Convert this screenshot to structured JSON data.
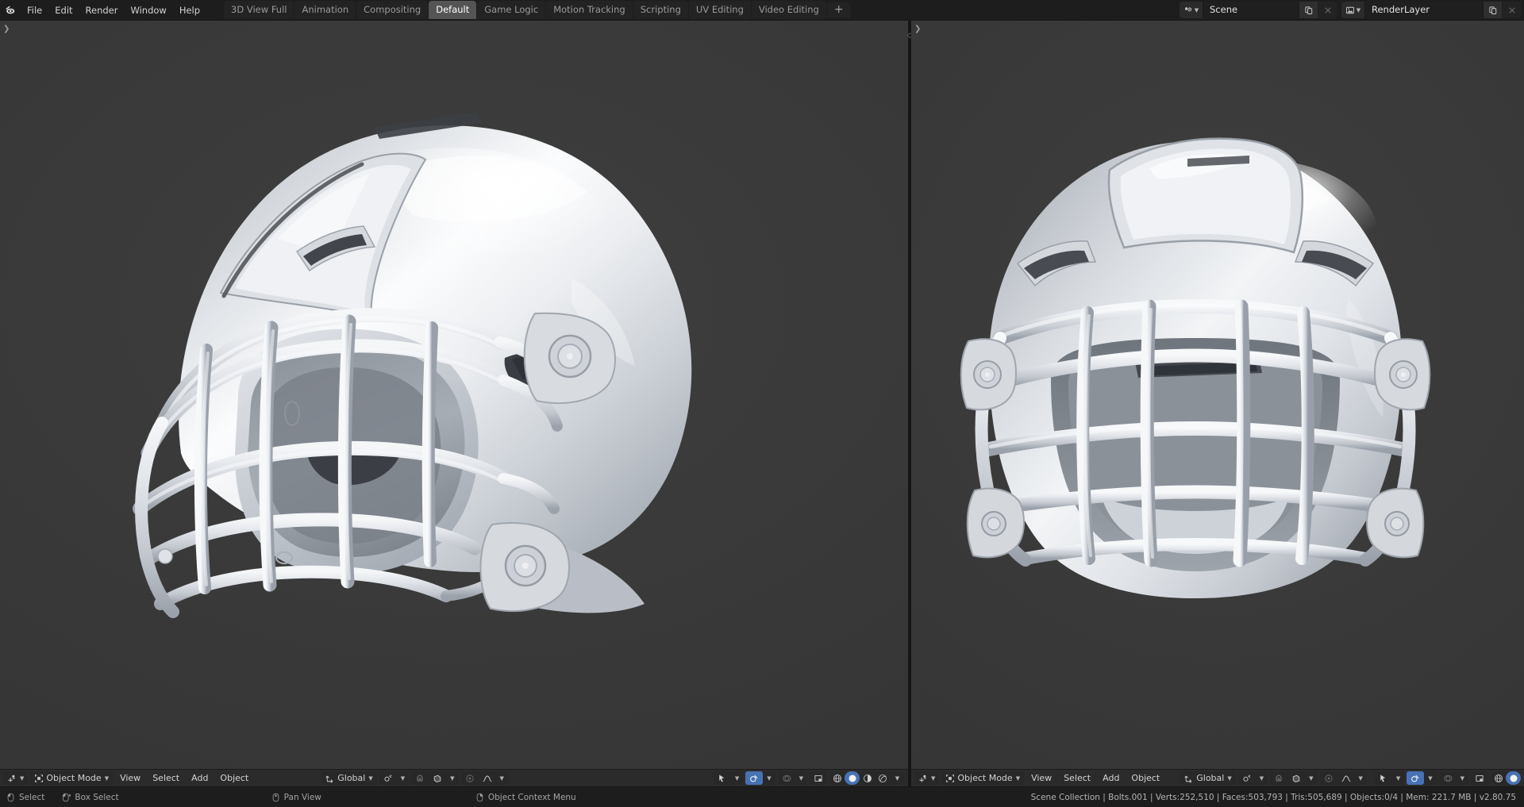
{
  "app": {
    "name": "Blender",
    "version_label": "v2.80.75"
  },
  "topbar": {
    "logo_icon": "blender-logo-icon",
    "menus": [
      "File",
      "Edit",
      "Render",
      "Window",
      "Help"
    ],
    "workspace_tabs": [
      {
        "label": "3D View Full",
        "active": false
      },
      {
        "label": "Animation",
        "active": false
      },
      {
        "label": "Compositing",
        "active": false
      },
      {
        "label": "Default",
        "active": true
      },
      {
        "label": "Game Logic",
        "active": false
      },
      {
        "label": "Motion Tracking",
        "active": false
      },
      {
        "label": "Scripting",
        "active": false
      },
      {
        "label": "UV Editing",
        "active": false
      },
      {
        "label": "Video Editing",
        "active": false
      }
    ],
    "add_workspace_label": "+",
    "scene_selector": {
      "icon": "scene-icon",
      "dropdown_icon": "chevron-down-icon",
      "value": "Scene",
      "new_icon": "duplicate-icon",
      "delete_icon": "close-icon"
    },
    "view_layer_selector": {
      "icon": "render-layer-icon",
      "dropdown_icon": "chevron-down-icon",
      "value": "RenderLayer",
      "new_icon": "duplicate-icon",
      "delete_icon": "close-icon"
    }
  },
  "viewports": [
    {
      "id": "left-viewport",
      "corner_expand_icon": "sidebar-expand-arrow-icon",
      "header": {
        "editor_type_icon": "editor-type-3dview-icon",
        "mode_icon": "object-mode-icon",
        "mode_label": "Object Mode",
        "menus": [
          "View",
          "Select",
          "Add",
          "Object"
        ],
        "transform_orientation": {
          "icon": "orientation-axis-icon",
          "label": "Global"
        },
        "snap_icon": "snap-magnet-icon",
        "snap_target_icon": "snap-increment-icon",
        "proportional_edit_icon": "proportional-edit-icon",
        "proportional_falloff_icon": "falloff-smooth-icon",
        "gizmo_icon": "gizmo-icon",
        "overlays_icon": "overlays-icon",
        "xray_icon": "xray-toggle-icon",
        "shading_modes": [
          {
            "name": "wireframe-shading",
            "active": false
          },
          {
            "name": "solid-shading",
            "active": true
          },
          {
            "name": "material-preview-shading",
            "active": false
          },
          {
            "name": "rendered-shading",
            "active": false
          }
        ],
        "shading_dropdown_icon": "chevron-down-icon"
      },
      "scene_object": "football-helmet-side-view"
    },
    {
      "id": "right-viewport",
      "header": {
        "editor_type_icon": "editor-type-3dview-icon",
        "mode_icon": "object-mode-icon",
        "mode_label": "Object Mode",
        "menus": [
          "View",
          "Select",
          "Add",
          "Object"
        ],
        "transform_orientation": {
          "icon": "orientation-axis-icon",
          "label": "Global"
        },
        "snap_icon": "snap-magnet-icon",
        "snap_target_icon": "snap-increment-icon",
        "proportional_edit_icon": "proportional-edit-icon",
        "proportional_falloff_icon": "falloff-smooth-icon",
        "gizmo_icon": "gizmo-icon",
        "overlays_icon": "overlays-icon",
        "xray_icon": "xray-toggle-icon",
        "shading_modes": [
          {
            "name": "wireframe-shading",
            "active": false
          },
          {
            "name": "solid-shading",
            "active": true
          },
          {
            "name": "material-preview-shading",
            "active": false
          },
          {
            "name": "rendered-shading",
            "active": false
          }
        ],
        "shading_dropdown_icon": "chevron-down-icon"
      },
      "scene_object": "football-helmet-front-view"
    }
  ],
  "statusbar": {
    "mouse_hints": [
      {
        "icon": "mouse-left-icon",
        "label": "Select"
      },
      {
        "icon": "mouse-left-drag-icon",
        "label": "Box Select"
      },
      {
        "icon": "mouse-middle-icon",
        "label": "Pan View"
      },
      {
        "icon": "mouse-right-icon",
        "label": "Object Context Menu"
      }
    ],
    "scene_stats": "Scene Collection | Bolts.001 | Verts:252,510 | Faces:503,793 | Tris:505,689 | Objects:0/4 | Mem: 221.7 MB | v2.80.75",
    "stats_fields": {
      "collection": "Scene Collection",
      "active_object": "Bolts.001",
      "verts": "Verts:252,510",
      "faces": "Faces:503,793",
      "tris": "Tris:505,689",
      "objects": "Objects:0/4",
      "memory": "Mem: 221.7 MB",
      "version": "v2.80.75"
    }
  },
  "colors": {
    "window_bg": "#1d1d1d",
    "header_bg": "#2b2b2b",
    "viewport_bg": "#3a3a3a",
    "accent_blue": "#4772b3",
    "text_primary": "#d3d3d3",
    "text_dim": "#9a9a9a",
    "helmet_shell": "#e9ebee",
    "helmet_mask": "#d9dbdf"
  }
}
